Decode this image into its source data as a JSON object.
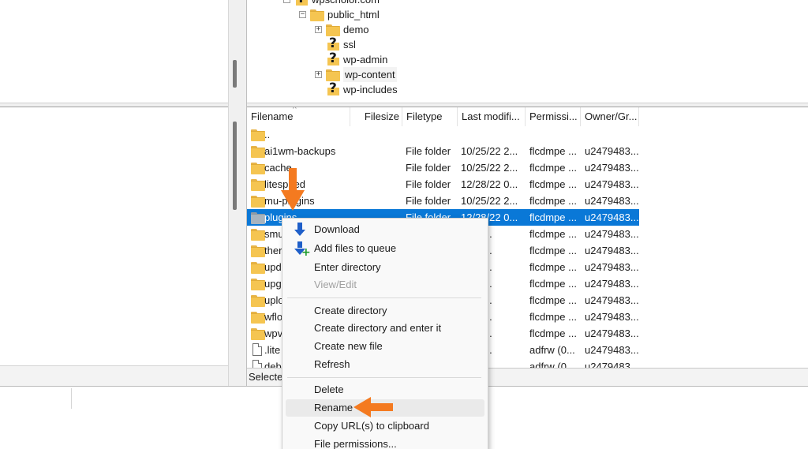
{
  "tree": {
    "nodes": [
      {
        "label": "wpscholor.com",
        "icon": "question-folder-icon",
        "expander": "−"
      },
      {
        "label": "public_html",
        "icon": "folder-icon",
        "expander": "−"
      },
      {
        "label": "demo",
        "icon": "folder-icon",
        "expander": "+"
      },
      {
        "label": "ssl",
        "icon": "question-folder-icon",
        "expander": ""
      },
      {
        "label": "wp-admin",
        "icon": "question-folder-icon",
        "expander": ""
      },
      {
        "label": "wp-content",
        "icon": "folder-icon",
        "expander": "+"
      },
      {
        "label": "wp-includes",
        "icon": "question-folder-icon",
        "expander": ""
      }
    ]
  },
  "list": {
    "columns": [
      "Filename",
      "Filesize",
      "Filetype",
      "Last modifi...",
      "Permissi...",
      "Owner/Gr..."
    ],
    "sort_indicator": "^",
    "rows": [
      {
        "name": "..",
        "size": "",
        "type": "",
        "modified": "",
        "perm": "",
        "owner": "",
        "icon": "folder-icon"
      },
      {
        "name": "ai1wm-backups",
        "size": "",
        "type": "File folder",
        "modified": "10/25/22 2...",
        "perm": "flcdmpe ...",
        "owner": "u2479483...",
        "icon": "folder-icon"
      },
      {
        "name": "cache",
        "size": "",
        "type": "File folder",
        "modified": "10/25/22 2...",
        "perm": "flcdmpe ...",
        "owner": "u2479483...",
        "icon": "folder-icon"
      },
      {
        "name": "litespeed",
        "size": "",
        "type": "File folder",
        "modified": "12/28/22 0...",
        "perm": "flcdmpe ...",
        "owner": "u2479483...",
        "icon": "folder-icon"
      },
      {
        "name": "mu-plugins",
        "size": "",
        "type": "File folder",
        "modified": "10/25/22 2...",
        "perm": "flcdmpe ...",
        "owner": "u2479483...",
        "icon": "folder-icon"
      },
      {
        "name": "plugins",
        "size": "",
        "type": "File folder",
        "modified": "12/28/22 0...",
        "perm": "flcdmpe ...",
        "owner": "u2479483...",
        "icon": "folder-icon",
        "selected": true
      },
      {
        "name": "smu",
        "size": "",
        "type": "",
        "modified": "/22 2...",
        "perm": "flcdmpe ...",
        "owner": "u2479483...",
        "icon": "folder-icon"
      },
      {
        "name": "ther",
        "size": "",
        "type": "",
        "modified": "/22 1...",
        "perm": "flcdmpe ...",
        "owner": "u2479483...",
        "icon": "folder-icon"
      },
      {
        "name": "upd",
        "size": "",
        "type": "",
        "modified": "/22 2...",
        "perm": "flcdmpe ...",
        "owner": "u2479483...",
        "icon": "folder-icon"
      },
      {
        "name": "upg",
        "size": "",
        "type": "",
        "modified": "/22 0...",
        "perm": "flcdmpe ...",
        "owner": "u2479483...",
        "icon": "folder-icon"
      },
      {
        "name": "uplo",
        "size": "",
        "type": "",
        "modified": "/23 0...",
        "perm": "flcdmpe ...",
        "owner": "u2479483...",
        "icon": "folder-icon"
      },
      {
        "name": "wflo",
        "size": "",
        "type": "",
        "modified": "/22 0...",
        "perm": "flcdmpe ...",
        "owner": "u2479483...",
        "icon": "folder-icon"
      },
      {
        "name": "wpv",
        "size": "",
        "type": "",
        "modified": "/22 2...",
        "perm": "flcdmpe ...",
        "owner": "u2479483...",
        "icon": "folder-icon"
      },
      {
        "name": ".lite",
        "size": "",
        "type": "",
        "modified": "/22 1...",
        "perm": "adfrw (0...",
        "owner": "u2479483...",
        "icon": "file-icon"
      },
      {
        "name": "deb",
        "size": "",
        "type": "",
        "modified": "/23 1...",
        "perm": "adfrw (0...",
        "owner": "u2479483...",
        "icon": "file-icon"
      }
    ]
  },
  "status": {
    "text": "Selecte"
  },
  "context_menu": {
    "items": [
      {
        "label": "Download",
        "icon": "download-icon",
        "enabled": true
      },
      {
        "label": "Add files to queue",
        "icon": "add-queue-icon",
        "enabled": true
      },
      {
        "label": "Enter directory",
        "icon": "",
        "enabled": true
      },
      {
        "label": "View/Edit",
        "icon": "",
        "enabled": false
      },
      {
        "label": "Create directory",
        "icon": "",
        "enabled": true
      },
      {
        "label": "Create directory and enter it",
        "icon": "",
        "enabled": true
      },
      {
        "label": "Create new file",
        "icon": "",
        "enabled": true
      },
      {
        "label": "Refresh",
        "icon": "",
        "enabled": true
      },
      {
        "label": "Delete",
        "icon": "",
        "enabled": true
      },
      {
        "label": "Rename",
        "icon": "",
        "enabled": true,
        "highlighted": true
      },
      {
        "label": "Copy URL(s) to clipboard",
        "icon": "",
        "enabled": true
      },
      {
        "label": "File permissions...",
        "icon": "",
        "enabled": true
      }
    ]
  },
  "colors": {
    "selection": "#0a78d7",
    "annotation_arrow": "#f47a20",
    "folder": "#f5c551"
  }
}
